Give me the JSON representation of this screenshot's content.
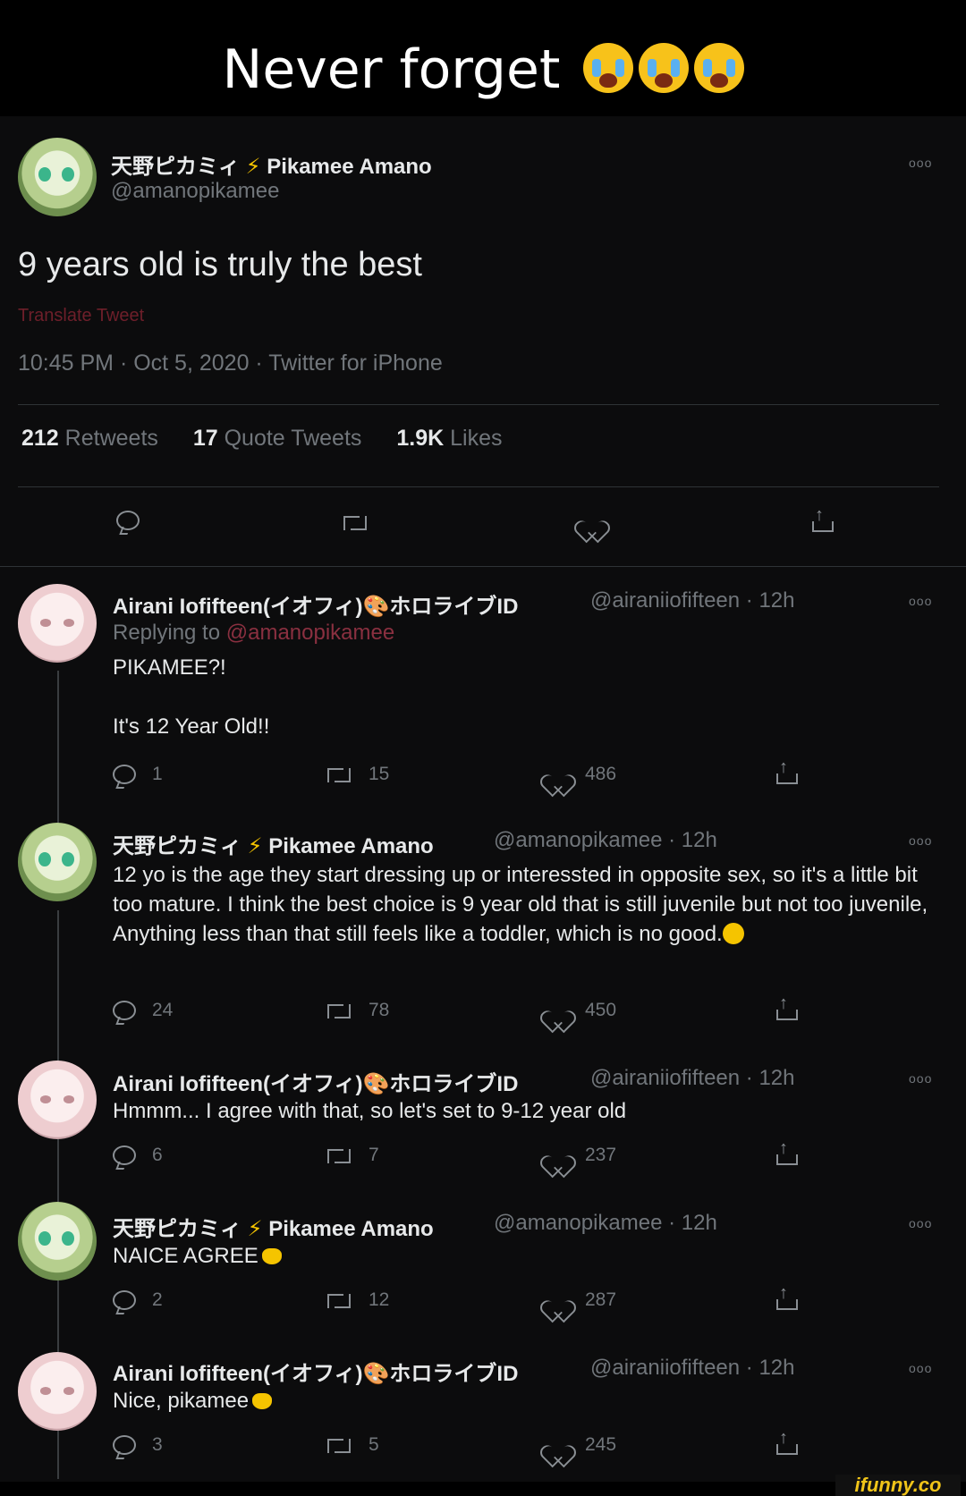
{
  "caption": {
    "text": "Never forget"
  },
  "main_tweet": {
    "display_name": "天野ピカミィ",
    "name_en": "Pikamee Amano",
    "handle": "@amanopikamee",
    "text": "9 years old is truly the best",
    "translate": "Translate Tweet",
    "meta": "10:45 PM · Oct 5, 2020 · Twitter for iPhone",
    "stats": {
      "retweets_count": "212",
      "retweets_label": "Retweets",
      "quotes_count": "17",
      "quotes_label": "Quote Tweets",
      "likes_count": "1.9K",
      "likes_label": "Likes"
    },
    "more": "ooo"
  },
  "replies": [
    {
      "name": "Airani Iofifteen(イオフィ)🎨ホロライブID",
      "handle": "@airaniiofifteen · 12h",
      "replying_label": "Replying to",
      "replying_handle": "@amanopikamee",
      "line1": "PIKAMEE?!",
      "line2": "It's 12 Year Old!!",
      "replies": "1",
      "retweets": "15",
      "likes": "486"
    },
    {
      "display_name": "天野ピカミィ",
      "name_en": "Pikamee Amano",
      "handle": "@amanopikamee · 12h",
      "text": "12 yo is the age they start dressing up or interessted in opposite sex, so it's a little bit too mature. I think the best choice is 9 year old that is still juvenile but not too juvenile, Anything less than that still feels like a toddler, which is no good.",
      "replies": "24",
      "retweets": "78",
      "likes": "450"
    },
    {
      "name": "Airani Iofifteen(イオフィ)🎨ホロライブID",
      "handle": "@airaniiofifteen · 12h",
      "text": "Hmmm... I agree with that, so let's set to 9-12 year old",
      "replies": "6",
      "retweets": "7",
      "likes": "237"
    },
    {
      "display_name": "天野ピカミィ",
      "name_en": "Pikamee Amano",
      "handle": "@amanopikamee · 12h",
      "text": "NAICE AGREE",
      "replies": "2",
      "retweets": "12",
      "likes": "287"
    },
    {
      "name": "Airani Iofifteen(イオフィ)🎨ホロライブID",
      "handle": "@airaniiofifteen · 12h",
      "text": "Nice, pikamee",
      "replies": "3",
      "retweets": "5",
      "likes": "245"
    }
  ],
  "watermark": "ifunny.co",
  "colors": {
    "background": "#000000",
    "panel": "#0c0c0d",
    "muted": "#71767b",
    "text": "#e7e9ea",
    "bolt": "#f5c400"
  },
  "icons": [
    "crying-emoji",
    "lightning-icon",
    "reply-icon",
    "retweet-icon",
    "like-icon",
    "share-icon",
    "more-icon"
  ]
}
